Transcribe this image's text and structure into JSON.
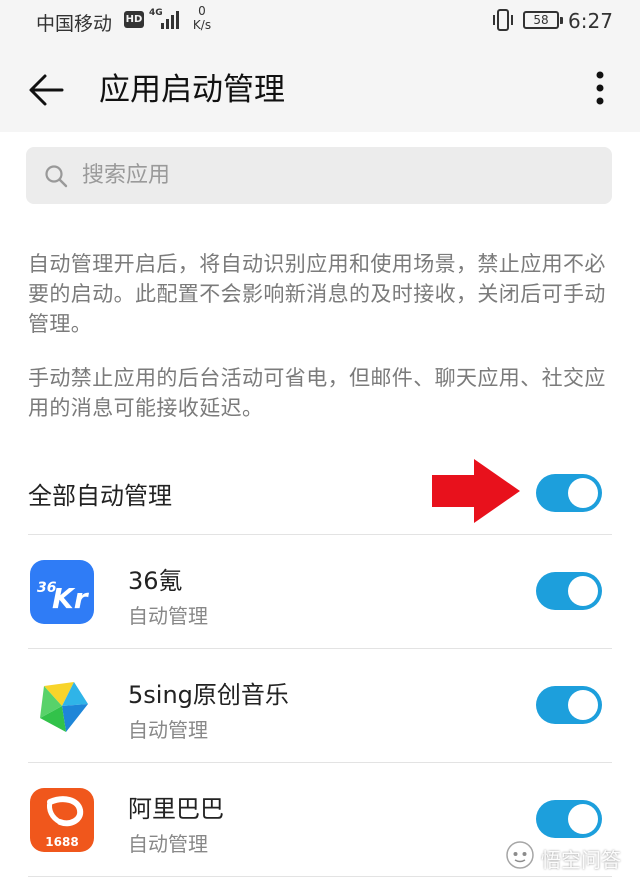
{
  "status_bar": {
    "carrier": "中国移动",
    "hd": "HD",
    "network": "4G",
    "speed_value": "0",
    "speed_unit": "K/s",
    "battery": "58",
    "time": "6:27"
  },
  "toolbar": {
    "back_icon": "arrow-left-icon",
    "title": "应用启动管理",
    "more_icon": "more-vertical-icon"
  },
  "search": {
    "icon": "search-icon",
    "placeholder": "搜索应用",
    "value": ""
  },
  "descriptions": [
    "自动管理开启后，将自动识别应用和使用场景，禁止应用不必要的启动。此配置不会影响新消息的及时接收，关闭后可手动管理。",
    "手动禁止应用的后台活动可省电，但邮件、聊天应用、社交应用的消息可能接收延迟。"
  ],
  "master": {
    "label": "全部自动管理",
    "enabled": true
  },
  "apps": [
    {
      "name": "36氪",
      "status": "自动管理",
      "icon_text": "36Kr",
      "enabled": true
    },
    {
      "name": "5sing原创音乐",
      "status": "自动管理",
      "enabled": true
    },
    {
      "name": "阿里巴巴",
      "status": "自动管理",
      "icon_text": "1688",
      "enabled": true
    }
  ],
  "colors": {
    "toggle_on": "#1d9fdc",
    "annotation_arrow": "#e8111c",
    "header_bg": "#f5f5f5"
  },
  "watermark": {
    "text": "悟空问答"
  }
}
